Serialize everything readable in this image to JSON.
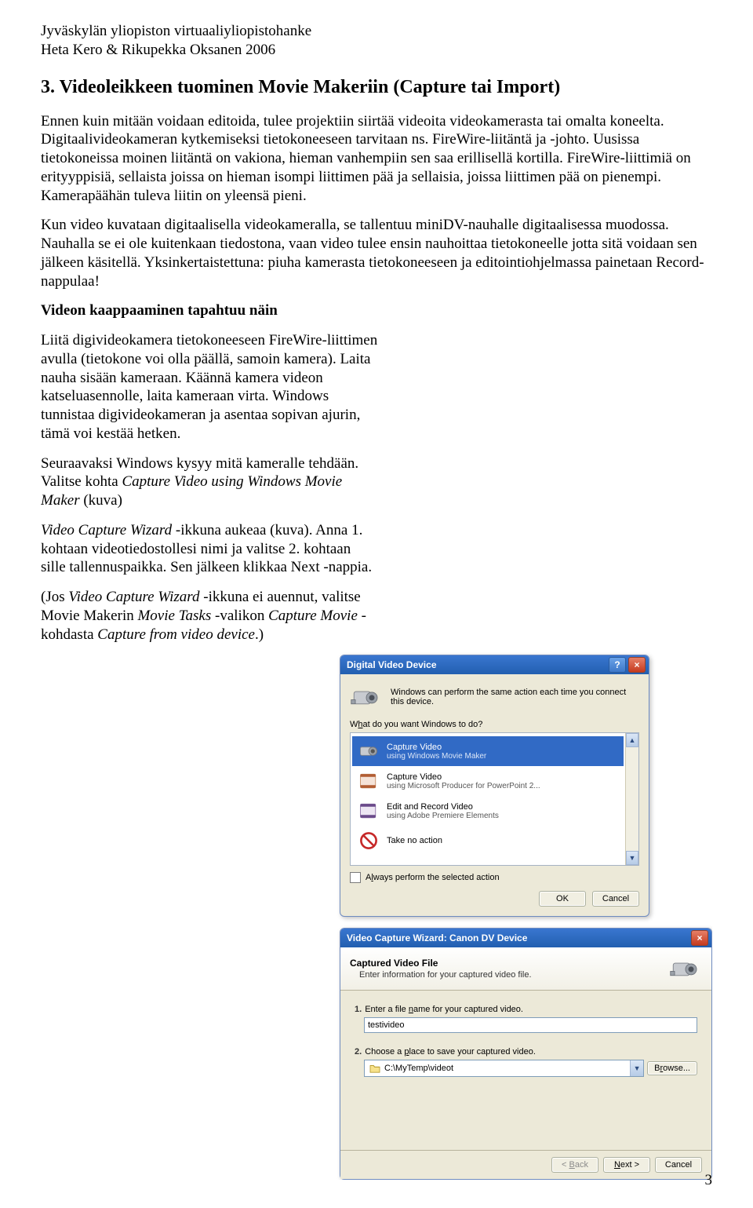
{
  "doc": {
    "header_line1": "Jyväskylän yliopiston virtuaaliyliopistohanke",
    "header_line2": "Heta Kero & Rikupekka Oksanen 2006",
    "heading": "3.  Videoleikkeen tuominen Movie Makeriin (Capture tai Import)",
    "p1": "Ennen kuin mitään voidaan editoida, tulee projektiin siirtää videoita videokamerasta tai omalta koneelta. Digitaalivideokameran kytkemiseksi tietokoneeseen tarvitaan ns. FireWire-liitäntä ja -johto. Uusissa tietokoneissa moinen liitäntä on vakiona, hieman vanhempiin sen saa erillisellä kortilla. FireWire-liittimiä on erityyppisiä, sellaista joissa on hieman isompi liittimen pää ja sellaisia, joissa liittimen pää on pienempi. Kamerapäähän tuleva liitin on yleensä pieni.",
    "p2": "Kun video kuvataan digitaalisella videokameralla, se tallentuu miniDV-nauhalle digitaalisessa muodossa. Nauhalla se ei ole kuitenkaan tiedostona, vaan video tulee ensin nauhoittaa tietokoneelle jotta sitä voidaan sen jälkeen käsitellä. Yksinkertaistettuna: piuha kamerasta tietokoneeseen ja editointiohjelmassa painetaan Record-nappulaa!",
    "subheading": "Videon kaappaaminen tapahtuu näin",
    "p3": "Liitä digivideokamera tietokoneeseen FireWire-liittimen avulla (tietokone voi olla päällä, samoin kamera). Laita nauha sisään kameraan. Käännä kamera videon katseluasennolle, laita kameraan virta. Windows tunnistaa digivideokameran ja asentaa sopivan ajurin, tämä voi kestää hetken.",
    "p4a": "Seuraavaksi Windows kysyy mitä kameralle tehdään. Valitse kohta ",
    "p4b_italic": "Capture Video using Windows Movie Maker",
    "p4c": " (kuva)",
    "p5a_italic": "Video Capture Wizard",
    "p5b": " -ikkuna aukeaa (kuva). Anna 1. kohtaan videotiedostollesi nimi ja valitse 2. kohtaan sille tallennuspaikka. Sen jälkeen klikkaa Next -nappia.",
    "p6a": "(Jos ",
    "p6b_italic": "Video Capture Wizard",
    "p6c": " -ikkuna ei auennut, valitse Movie Makerin ",
    "p6d_italic": "Movie Tasks",
    "p6e": " -valikon ",
    "p6f_italic": "Capture Movie",
    "p6g": " -kohdasta ",
    "p6h_italic": "Capture from video device",
    "p6i": ".)",
    "page_number": "3"
  },
  "dvd_dialog": {
    "title": "Digital Video Device",
    "intro": "Windows can perform the same action each time you connect this device.",
    "prompt_pre": "W",
    "prompt_u": "h",
    "prompt_post": "at do you want Windows to do?",
    "items": [
      {
        "title": "Capture Video",
        "sub": "using Windows Movie Maker"
      },
      {
        "title": "Capture Video",
        "sub": "using Microsoft Producer for PowerPoint 2..."
      },
      {
        "title": "Edit and Record Video",
        "sub": "using Adobe Premiere Elements"
      },
      {
        "title": "Take no action",
        "sub": ""
      }
    ],
    "always_pre": "A",
    "always_u": "l",
    "always_post": "ways perform the selected action",
    "ok": "OK",
    "cancel": "Cancel"
  },
  "wizard": {
    "title": "Video Capture Wizard: Canon DV Device",
    "header_title": "Captured Video File",
    "header_sub": "Enter information for your captured video file.",
    "step1_num": "1.",
    "step1_pre": "Enter a file ",
    "step1_u": "n",
    "step1_post": "ame for your captured video.",
    "input_value": "testivideo",
    "step2_num": "2.",
    "step2_pre": "Choose a ",
    "step2_u": "p",
    "step2_post": "lace to save your captured video.",
    "folder_path": "C:\\MyTemp\\videot",
    "browse_pre": "B",
    "browse_u": "r",
    "browse_post": "owse...",
    "back_pre": "< ",
    "back_u": "B",
    "back_post": "ack",
    "next_pre": "",
    "next_u": "N",
    "next_post": "ext >",
    "cancel": "Cancel"
  }
}
